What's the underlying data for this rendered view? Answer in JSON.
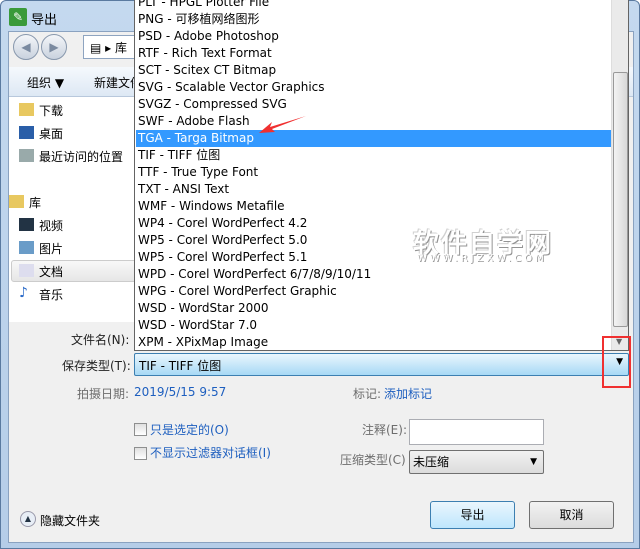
{
  "window": {
    "title": "导出",
    "logo": "coreldraw-logo"
  },
  "nav": {
    "address_crumb": "库"
  },
  "toolbar": {
    "organize": "组织 ▼",
    "new_folder": "新建文件夹"
  },
  "sidebar": {
    "items": [
      {
        "label": "下载",
        "icon": "download-folder-icon"
      },
      {
        "label": "桌面",
        "icon": "desktop-icon"
      },
      {
        "label": "最近访问的位置",
        "icon": "recent-places-icon"
      },
      {
        "label": "库",
        "icon": "library-icon"
      },
      {
        "label": "视频",
        "icon": "video-icon"
      },
      {
        "label": "图片",
        "icon": "pictures-icon"
      },
      {
        "label": "文档",
        "icon": "documents-icon",
        "selected": true
      },
      {
        "label": "音乐",
        "icon": "music-icon"
      }
    ]
  },
  "filetype_list": {
    "items": [
      "PLT - HPGL Plotter File",
      "PNG - 可移植网络图形",
      "PSD - Adobe Photoshop",
      "RTF - Rich Text Format",
      "SCT - Scitex CT Bitmap",
      "SVG - Scalable Vector Graphics",
      "SVGZ - Compressed SVG",
      "SWF - Adobe Flash",
      "TGA - Targa Bitmap",
      "TIF - TIFF 位图",
      "TTF - True Type Font",
      "TXT - ANSI Text",
      "WMF - Windows Metafile",
      "WP4 - Corel WordPerfect 4.2",
      "WP5 - Corel WordPerfect 5.0",
      "WP5 - Corel WordPerfect 5.1",
      "WPD - Corel WordPerfect 6/7/8/9/10/11",
      "WPG - Corel WordPerfect Graphic",
      "WSD - WordStar 2000",
      "WSD - WordStar 7.0",
      "XPM - XPixMap Image"
    ],
    "highlighted": "TGA - Targa Bitmap"
  },
  "form": {
    "filename_label": "文件名(N):",
    "savetype_label": "保存类型(T):",
    "savetype_value": "TIF - TIFF 位图",
    "date_label": "拍摄日期:",
    "date_value": "2019/5/15 9:57",
    "tags_label": "标记:",
    "tags_value": "添加标记",
    "only_selected": "只是选定的(O)",
    "no_filter_dialog": "不显示过滤器对话框(I)",
    "note_label": "注释(E):",
    "note_value": "",
    "compression_label": "压缩类型(C)",
    "compression_value": "未压缩"
  },
  "footer": {
    "hide_folders": "隐藏文件夹",
    "export": "导出",
    "cancel": "取消"
  },
  "watermark": {
    "text": "软件自学网",
    "url": "WWW.RJZXW.COM"
  },
  "colors": {
    "highlight": "#3399ff",
    "annotation": "#f03030"
  }
}
